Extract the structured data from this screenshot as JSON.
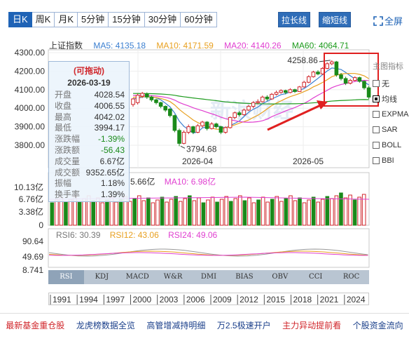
{
  "toolbar": {
    "periods": [
      {
        "label": "日K",
        "active": true
      },
      {
        "label": "周K",
        "active": false
      },
      {
        "label": "月K",
        "active": false
      },
      {
        "label": "5分钟",
        "active": false
      },
      {
        "label": "15分钟",
        "active": false
      },
      {
        "label": "30分钟",
        "active": false
      },
      {
        "label": "60分钟",
        "active": false
      }
    ],
    "stretch_label": "拉长线",
    "shrink_label": "缩短线",
    "fullscreen_label": "全屏"
  },
  "ma_legend": {
    "index_name": "上证指数",
    "ma5": "MA5: 4135.18",
    "ma10": "MA10: 4171.59",
    "ma20": "MA20: 4140.26",
    "ma60": "MA60: 4064.71"
  },
  "colors": {
    "up": "#d0262b",
    "down": "#1a8a1a",
    "ma5": "#3b7fd0",
    "ma10": "#e8a020",
    "ma20": "#e03fd0",
    "ma60": "#1c9a1c",
    "highlight": "#e02020"
  },
  "price_axis": [
    "4300.00",
    "4200.00",
    "4100.00",
    "4000.00",
    "3900.00",
    "3800.00"
  ],
  "date_axis": [
    "2026-04",
    "2026-05"
  ],
  "annotations": {
    "high": "4258.86",
    "low": "3794.68"
  },
  "infobox": {
    "drag_label": "(可拖动)",
    "date": "2026-03-19",
    "rows": [
      {
        "k": "开盘",
        "v": "4028.54"
      },
      {
        "k": "收盘",
        "v": "4006.55"
      },
      {
        "k": "最高",
        "v": "4042.02"
      },
      {
        "k": "最低",
        "v": "3994.17"
      },
      {
        "k": "涨跌幅",
        "v": "-1.39%"
      },
      {
        "k": "涨跌额",
        "v": "-56.43"
      },
      {
        "k": "成交量",
        "v": "6.67亿"
      },
      {
        "k": "成交额",
        "v": "9352.65亿"
      },
      {
        "k": "振幅",
        "v": "1.18%"
      },
      {
        "k": "换手率",
        "v": "1.39%"
      }
    ]
  },
  "indicators": {
    "title": "主图指标",
    "items": [
      {
        "label": "无",
        "checked": false
      },
      {
        "label": "均线",
        "checked": true
      },
      {
        "label": "EXPMA",
        "checked": false
      },
      {
        "label": "SAR",
        "checked": false
      },
      {
        "label": "BOLL",
        "checked": false
      },
      {
        "label": "BBI",
        "checked": false
      }
    ]
  },
  "volume": {
    "legend_ma5_tail": "5.66亿",
    "legend_ma10": "MA10: 6.98亿",
    "axis": [
      "10.13亿",
      "6.76亿",
      "3.38亿",
      "0"
    ]
  },
  "rsi": {
    "rsi6": "RSI6: 30.39",
    "rsi12": "RSI12: 43.06",
    "rsi24": "RSI24: 49.06",
    "axis": [
      "90.64",
      "49.69",
      "8.741"
    ]
  },
  "indicator_tabs": [
    "RSI",
    "KDJ",
    "MACD",
    "W&R",
    "DMI",
    "BIAS",
    "OBV",
    "CCI",
    "ROC"
  ],
  "years": [
    "1991",
    "1994",
    "1997",
    "2000",
    "2003",
    "2006",
    "2009",
    "2012",
    "2015",
    "2018",
    "2021",
    "2024"
  ],
  "footer_links": [
    {
      "label": "最新基金重仓股",
      "color": "#d0262b"
    },
    {
      "label": "龙虎榜数据全览",
      "color": "#1a3f8a"
    },
    {
      "label": "高管增减持明细",
      "color": "#1a3f8a"
    },
    {
      "label": "万2.5极速开户",
      "color": "#1a3f8a"
    },
    {
      "label": "主力异动提前看",
      "color": "#d0262b"
    },
    {
      "label": "个股资金流向",
      "color": "#1a3f8a"
    }
  ],
  "candles": [
    [
      4020,
      4050,
      4008,
      4055
    ],
    [
      4030,
      4070,
      4020,
      4078
    ],
    [
      4065,
      4080,
      4055,
      4088
    ],
    [
      4075,
      4060,
      4050,
      4085
    ],
    [
      4060,
      4045,
      4035,
      4068
    ],
    [
      4045,
      4030,
      4020,
      4052
    ],
    [
      4030,
      4010,
      4000,
      4035
    ],
    [
      4010,
      3990,
      3980,
      4015
    ],
    [
      3995,
      3960,
      3950,
      4000
    ],
    [
      3960,
      3880,
      3870,
      3965
    ],
    [
      3880,
      3810,
      3795,
      3890
    ],
    [
      3810,
      3870,
      3805,
      3880
    ],
    [
      3870,
      3900,
      3860,
      3912
    ],
    [
      3900,
      3870,
      3860,
      3905
    ],
    [
      3870,
      3905,
      3865,
      3915
    ],
    [
      3905,
      3925,
      3895,
      3932
    ],
    [
      3925,
      3890,
      3880,
      3930
    ],
    [
      3890,
      3915,
      3885,
      3925
    ],
    [
      3915,
      3900,
      3890,
      3922
    ],
    [
      3900,
      3870,
      3860,
      3905
    ],
    [
      3870,
      3895,
      3862,
      3902
    ],
    [
      3895,
      3950,
      3890,
      3955
    ],
    [
      3950,
      3975,
      3940,
      3982
    ],
    [
      3975,
      3965,
      3955,
      3985
    ],
    [
      3965,
      3990,
      3960,
      3998
    ],
    [
      3990,
      4010,
      3985,
      4018
    ],
    [
      4010,
      4030,
      4000,
      4038
    ],
    [
      4030,
      4035,
      4022,
      4048
    ],
    [
      4035,
      4060,
      4030,
      4068
    ],
    [
      4060,
      4050,
      4040,
      4070
    ],
    [
      4050,
      4075,
      4045,
      4082
    ],
    [
      4075,
      4085,
      4068,
      4095
    ],
    [
      4085,
      4095,
      4078,
      4102
    ],
    [
      4095,
      4085,
      4075,
      4100
    ],
    [
      4085,
      4100,
      4080,
      4108
    ],
    [
      4100,
      4090,
      4082,
      4105
    ],
    [
      4090,
      4115,
      4088,
      4120
    ],
    [
      4115,
      4140,
      4110,
      4148
    ],
    [
      4140,
      4170,
      4135,
      4178
    ],
    [
      4170,
      4195,
      4165,
      4202
    ],
    [
      4195,
      4185,
      4178,
      4205
    ],
    [
      4185,
      4215,
      4180,
      4222
    ],
    [
      4215,
      4240,
      4210,
      4248
    ],
    [
      4240,
      4250,
      4232,
      4259
    ],
    [
      4250,
      4180,
      4170,
      4255
    ],
    [
      4180,
      4160,
      4150,
      4190
    ],
    [
      4160,
      4135,
      4125,
      4170
    ],
    [
      4135,
      4150,
      4128,
      4158
    ],
    [
      4150,
      4165,
      4145,
      4172
    ],
    [
      4165,
      4145,
      4138,
      4170
    ],
    [
      4145,
      4110,
      4100,
      4150
    ],
    [
      4110,
      4060,
      4050,
      4120
    ]
  ]
}
